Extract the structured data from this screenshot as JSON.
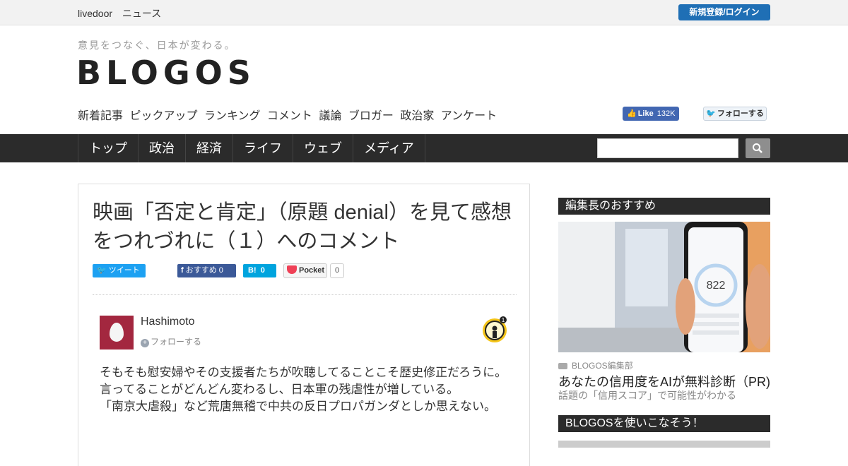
{
  "topbar": {
    "brand": "livedoor",
    "news": "ニュース",
    "login": "新規登録/ログイン"
  },
  "header": {
    "tagline": "意見をつなぐ、日本が変わる。",
    "logo": "BLOGOS"
  },
  "subnav": [
    "新着記事",
    "ピックアップ",
    "ランキング",
    "コメント",
    "議論",
    "ブロガー",
    "政治家",
    "アンケート"
  ],
  "social": {
    "fb_like": "Like",
    "fb_count": "132K",
    "tw_follow": "フォローする"
  },
  "mainnav": [
    "トップ",
    "政治",
    "経済",
    "ライフ",
    "ウェブ",
    "メディア"
  ],
  "search": {
    "placeholder": ""
  },
  "article": {
    "title": "映画「否定と肯定」（原題 denial）を見て感想をつれづれに（１）へのコメント",
    "share": {
      "tweet": "ツイート",
      "fb": "おすすめ",
      "fb_count": "0",
      "hatena_count": "0",
      "pocket": "Pocket",
      "pocket_count": "0"
    },
    "user": {
      "name": "Hashimoto",
      "follow": "フォローする",
      "badge_count": "1"
    },
    "comment_lines": [
      "そもそも慰安婦やその支援者たちが吹聴してることこそ歴史修正だろうに。",
      "言ってることがどんどん変わるし、日本軍の残虐性が増している。",
      "「南京大虐殺」など荒唐無稽で中共の反日プロパガンダとしか思えない。"
    ]
  },
  "sidebar": {
    "pick_title": "編集長のおすすめ",
    "pick_meta": "BLOGOS編集部",
    "pick_headline": "あなたの信用度をAIが無料診断（PR)",
    "pick_sub": "話題の「信用スコア」で可能性がわかる",
    "phone_score": "822",
    "use_title": "BLOGOSを使いこなそう！"
  },
  "colors": {
    "accent": "#1f6fb5",
    "nav": "#2b2b2b",
    "avatar": "#a3273f"
  }
}
